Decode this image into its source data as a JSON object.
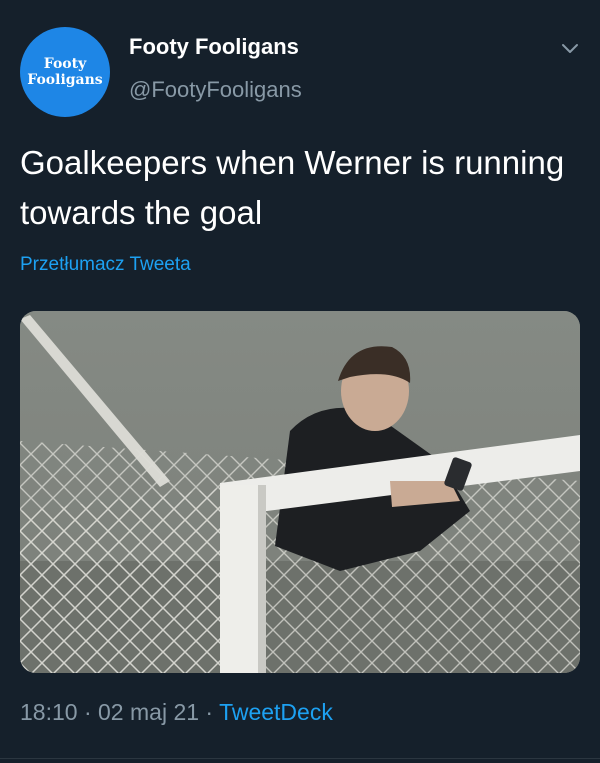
{
  "author": {
    "avatar_line1": "Footy",
    "avatar_line2": "Fooligans",
    "display_name": "Footy Fooligans",
    "handle": "@FootyFooligans"
  },
  "menu_icon": "chevron-down-icon",
  "tweet": {
    "text": "Goalkeepers when Werner is running towards the goal",
    "translate_link": "Przetłumacz Tweeta",
    "time": "18:10",
    "separator": " · ",
    "date": "02 maj 21",
    "source": "TweetDeck"
  },
  "colors": {
    "background": "#15202b",
    "accent": "#1da1f2",
    "muted": "#8899a6",
    "avatar_bg": "#1e86e6"
  }
}
